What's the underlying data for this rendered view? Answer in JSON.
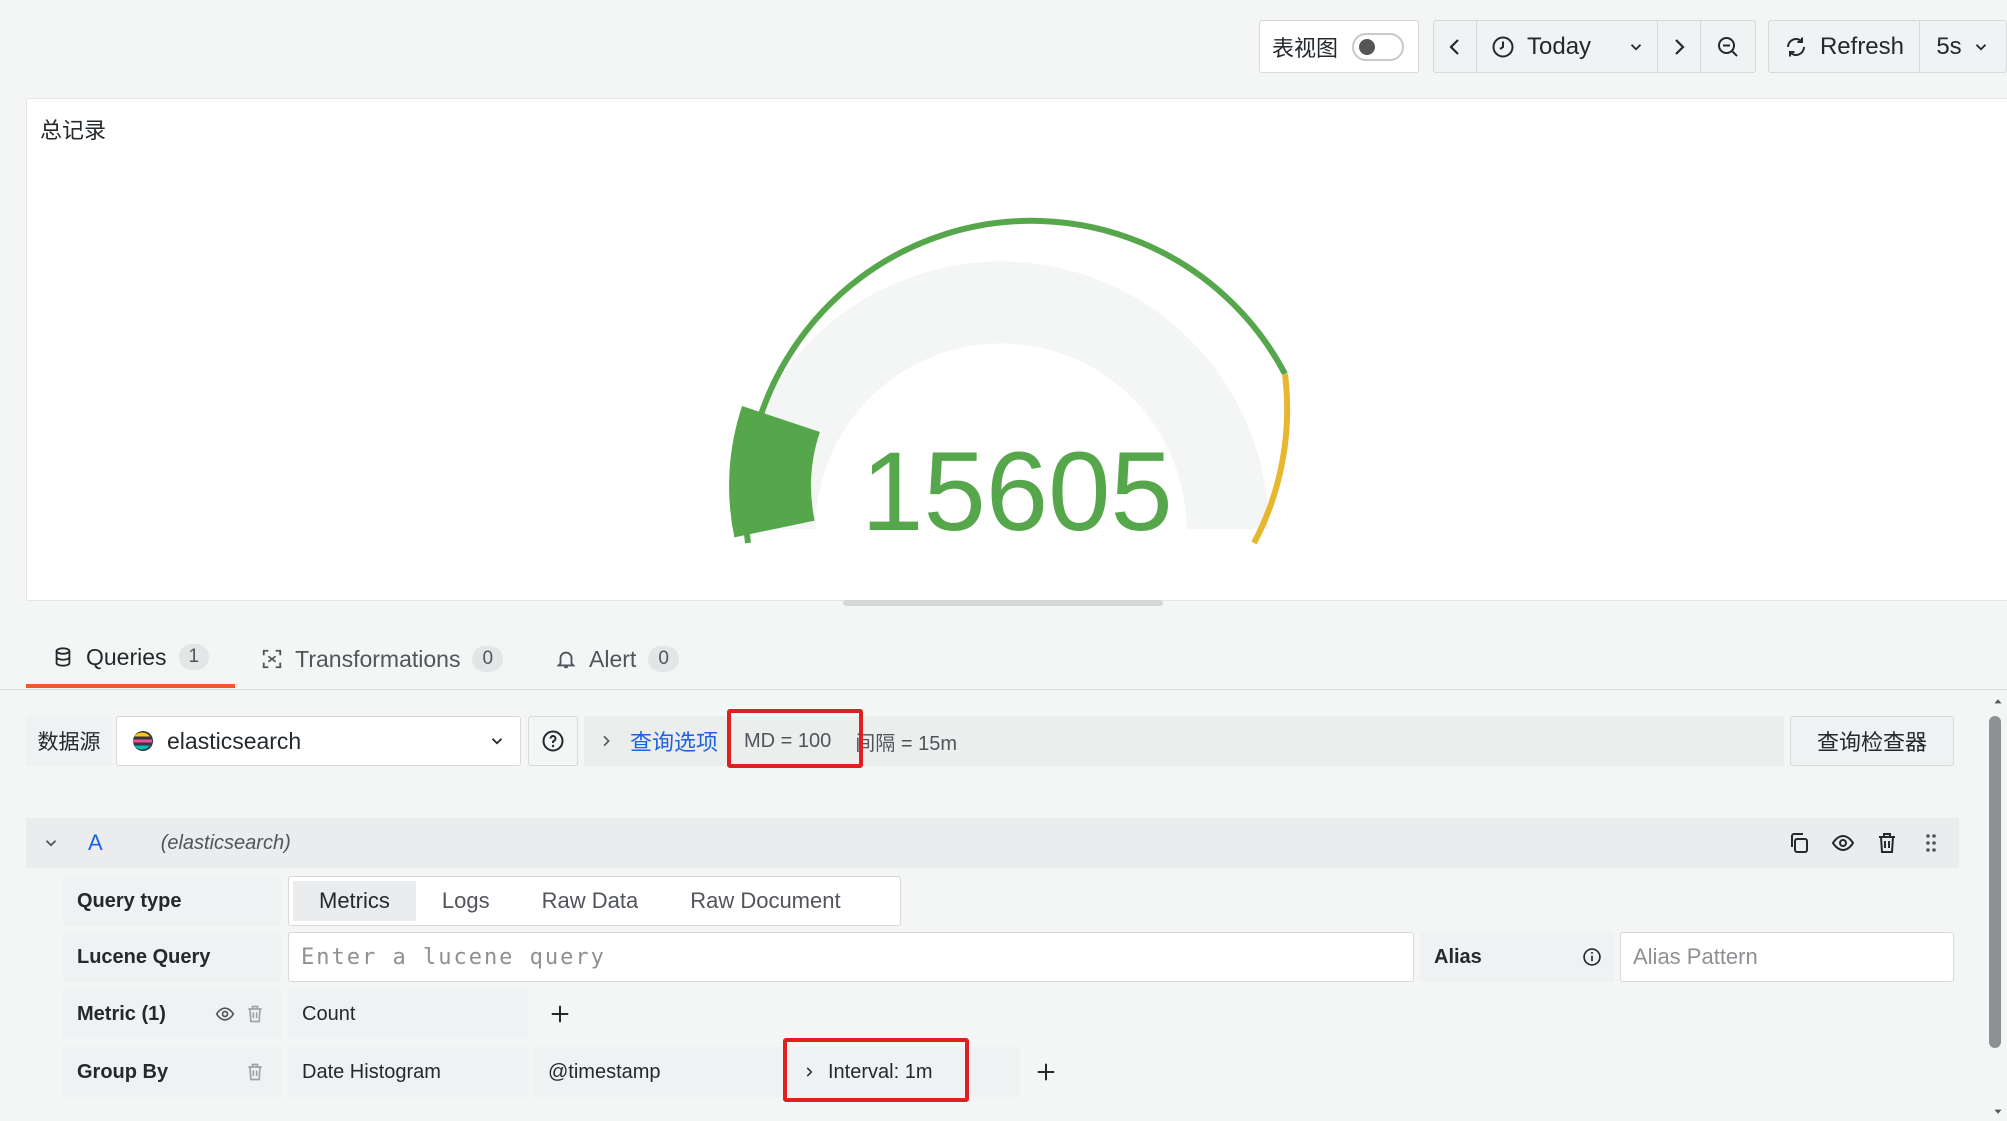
{
  "toolbar": {
    "table_view_label": "表视图",
    "time_range": "Today",
    "refresh_label": "Refresh",
    "refresh_interval": "5s"
  },
  "panel": {
    "title": "总记录",
    "gauge_value": "15605",
    "value_color": "#56a64b",
    "threshold_color": "#e8b730"
  },
  "tabs": [
    {
      "label": "Queries",
      "count": "1"
    },
    {
      "label": "Transformations",
      "count": "0"
    },
    {
      "label": "Alert",
      "count": "0"
    }
  ],
  "datasource": {
    "label": "数据源",
    "selected": "elasticsearch",
    "query_options_link": "查询选项",
    "max_data_points": "MD = 100",
    "interval": "间隔 = 15m",
    "inspector_label": "查询检查器"
  },
  "query": {
    "ref_id": "A",
    "datasource_hint": "(elasticsearch)",
    "query_type_label": "Query type",
    "query_types": [
      "Metrics",
      "Logs",
      "Raw Data",
      "Raw Document"
    ],
    "active_query_type": "Metrics",
    "lucene_label": "Lucene Query",
    "lucene_placeholder": "Enter a lucene query",
    "alias_label": "Alias",
    "alias_placeholder": "Alias Pattern",
    "metric_label": "Metric (1)",
    "metric_value": "Count",
    "group_by_label": "Group By",
    "group_by_type": "Date Histogram",
    "group_by_field": "@timestamp",
    "group_by_interval": "Interval: 1m"
  }
}
